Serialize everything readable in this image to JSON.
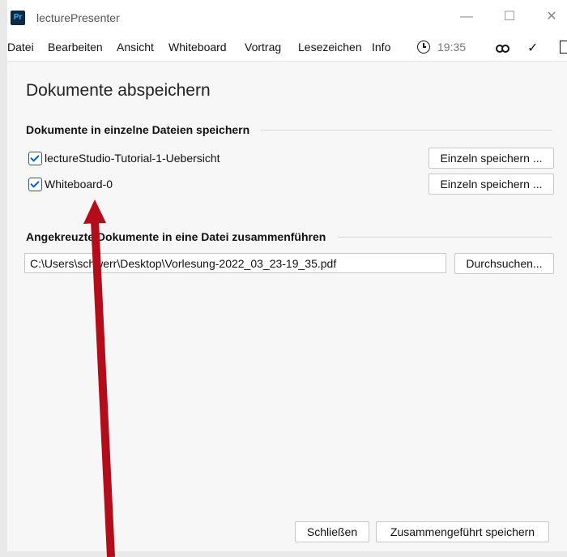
{
  "window": {
    "app_icon": "Pr",
    "title": "lecturePresenter",
    "controls": {
      "minimize_icon": "—",
      "maximize_icon": "☐",
      "close_icon": "✕"
    }
  },
  "menu": {
    "items": [
      "Datei",
      "Bearbeiten",
      "Ansicht",
      "Whiteboard",
      "Vortrag",
      "Lesezeichen",
      "Info"
    ],
    "time": "19:35"
  },
  "dialog": {
    "title": "Dokumente abspeichern",
    "section_single": "Dokumente in einzelne Dateien speichern",
    "documents": [
      {
        "name": "lectureStudio-Tutorial-1-Uebersicht",
        "checked": true,
        "button": "Einzeln speichern ..."
      },
      {
        "name": "Whiteboard-0",
        "checked": true,
        "button": "Einzeln speichern ..."
      }
    ],
    "section_merge": "Angekreuzte Dokumente in eine Datei zusammenführen",
    "merge_path": "C:\\Users\\schwerr\\Desktop\\Vorlesung-2022_03_23-19_35.pdf",
    "browse_button": "Durchsuchen...",
    "close_button": "Schließen",
    "save_merged_button": "Zusammengeführt speichern"
  },
  "annotation": {
    "arrow_color": "#b30d1c"
  }
}
